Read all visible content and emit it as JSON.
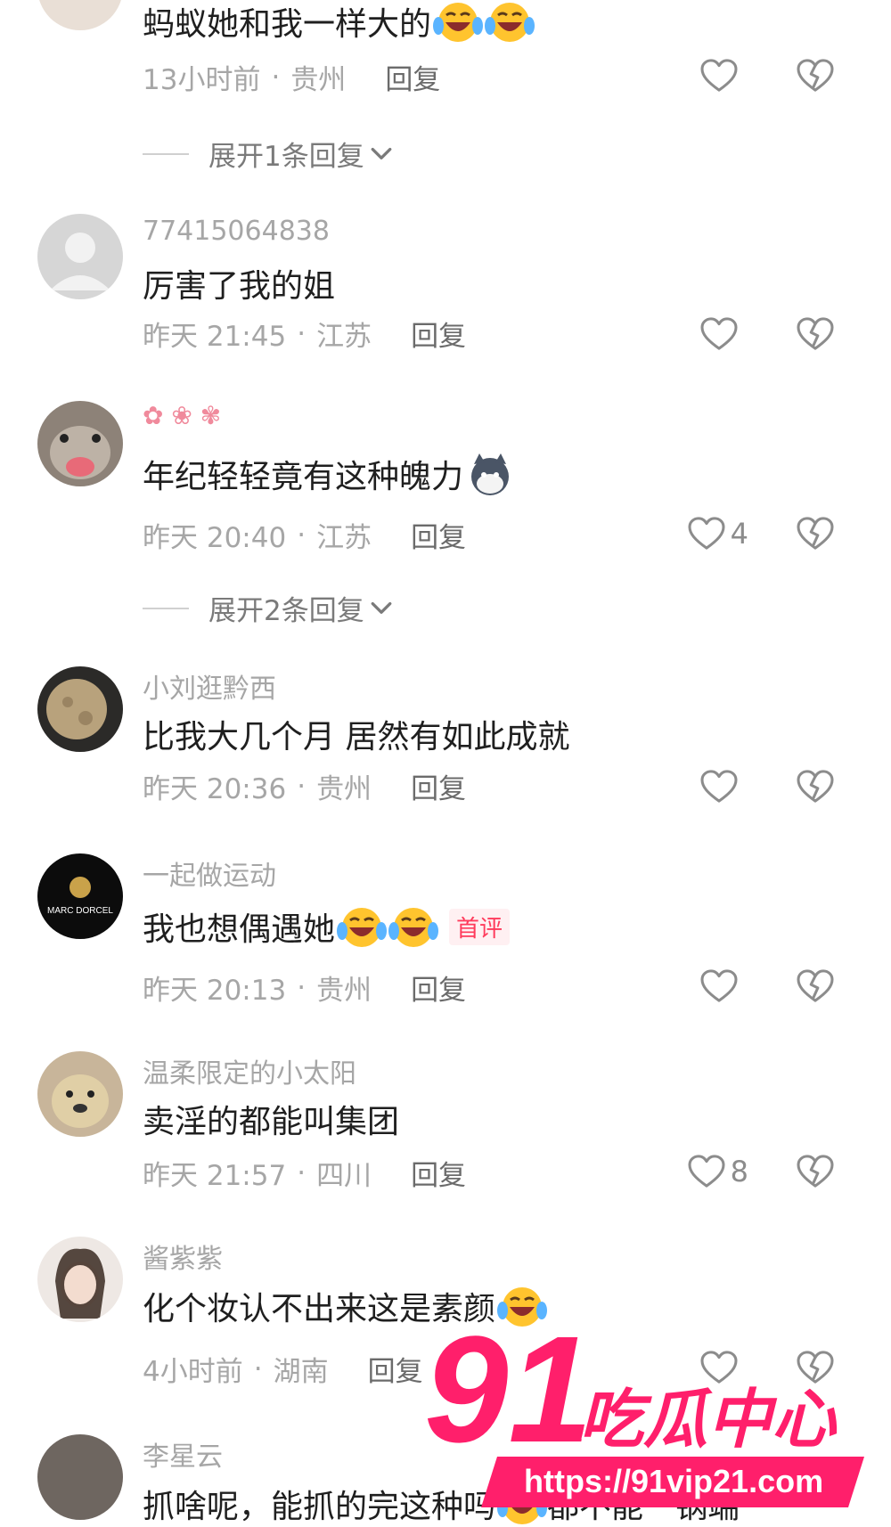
{
  "comments": [
    {
      "username": "",
      "text": "蚂蚁她和我一样大的",
      "time": "13小时前",
      "location": "贵州",
      "reply_label": "回复",
      "likes": "",
      "expand_label": "展开1条回复"
    },
    {
      "username": "77415064838",
      "text": "厉害了我的姐",
      "time": "昨天 21:45",
      "location": "江苏",
      "reply_label": "回复",
      "likes": ""
    },
    {
      "username": "",
      "text": "年纪轻轻竟有这种魄力",
      "time": "昨天 20:40",
      "location": "江苏",
      "reply_label": "回复",
      "likes": "4",
      "expand_label": "展开2条回复"
    },
    {
      "username": "小刘逛黔西",
      "text": "比我大几个月 居然有如此成就",
      "time": "昨天 20:36",
      "location": "贵州",
      "reply_label": "回复",
      "likes": ""
    },
    {
      "username": "一起做运动",
      "text": "我也想偶遇她",
      "badge": "首评",
      "avatar_text": "MARC DORCEL",
      "time": "昨天 20:13",
      "location": "贵州",
      "reply_label": "回复",
      "likes": ""
    },
    {
      "username": "温柔限定的小太阳",
      "text": "卖淫的都能叫集团",
      "time": "昨天 21:57",
      "location": "四川",
      "reply_label": "回复",
      "likes": "8"
    },
    {
      "username": "酱紫紫",
      "text": "化个妆认不出来这是素颜",
      "time": "4小时前",
      "location": "湖南",
      "reply_label": "回复",
      "likes": ""
    },
    {
      "username": "李星云",
      "text": "抓啥呢，能抓的完这种吗",
      "text_after": "都不能一锅端",
      "likes": ""
    }
  ],
  "watermark": {
    "number": "91",
    "title": "吃瓜中心",
    "url": "https://91vip21.com"
  },
  "colors": {
    "accent_pink": "#ff1f6b",
    "badge_red": "#ff3b5c",
    "meta_gray": "#a6a6a6"
  },
  "icons": {
    "like": "heart-outline-icon",
    "dislike": "broken-heart-icon",
    "expand": "chevron-down-icon",
    "emoji_laugh_cry": "laughing-crying-emoji",
    "emoji_husky": "husky-emoji"
  }
}
